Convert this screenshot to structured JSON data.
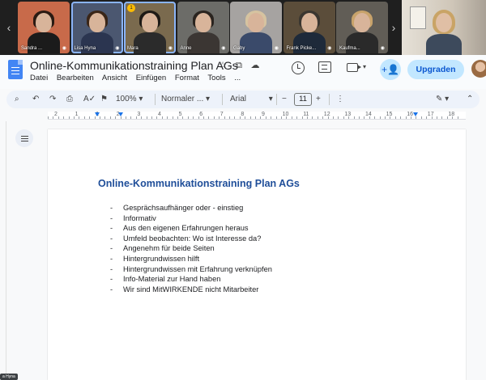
{
  "meeting": {
    "participants": [
      {
        "name": "Sandra ...",
        "bg": "#c86a4a",
        "hair": "#2b1a12",
        "shirt": "#1b1b1b",
        "hand": false,
        "active": false
      },
      {
        "name": "Lisa Hyna",
        "bg": "#4b5770",
        "hair": "#3a2618",
        "shirt": "#2b3550",
        "hand": false,
        "active": true
      },
      {
        "name": "Mara",
        "bg": "#7a6a4e",
        "hair": "#1e1a16",
        "shirt": "#2b2b2b",
        "hand": true,
        "active": true
      },
      {
        "name": "Anne",
        "bg": "#6c6c68",
        "hair": "#2a241f",
        "shirt": "#3b3633",
        "hand": false,
        "active": false
      },
      {
        "name": "Gaby",
        "bg": "#a6a3a1",
        "hair": "#d6c3a0",
        "shirt": "#3a4a6a",
        "hand": false,
        "active": false
      },
      {
        "name": "Frank Picke...",
        "bg": "#5b4d3a",
        "hair": "#3a3630",
        "shirt": "#1e2a3a",
        "hand": false,
        "active": false
      },
      {
        "name": "Kaufma...",
        "bg": "#615d56",
        "hair": "#c8a36b",
        "shirt": "#2a2a2a",
        "hand": false,
        "active": false
      }
    ],
    "hand_badge": "1",
    "self_label": "a Hyna"
  },
  "doc": {
    "title": "Online-Kommunikationstraining Plan AGs",
    "menu": [
      "Datei",
      "Bearbeiten",
      "Ansicht",
      "Einfügen",
      "Format",
      "Tools",
      "..."
    ],
    "upgrade_label": "Upgraden",
    "heading": "Online-Kommunikationstraining Plan AGs",
    "bullets": [
      "Gesprächsaufhänger oder - einstieg",
      "Informativ",
      "Aus den eigenen Erfahrungen heraus",
      "Umfeld beobachten: Wo ist Interesse da?",
      "Angenehm für beide Seiten",
      "Hintergrundwissen hilft",
      "Hintergrundwissen mit Erfahrung verknüpfen",
      "Info-Material zur Hand haben",
      "Wir sind MitWIRKENDE nicht Mitarbeiter"
    ]
  },
  "toolbar": {
    "zoom": "100%",
    "style": "Normaler ...",
    "font": "Arial",
    "font_size": "11"
  },
  "ruler": {
    "numbers": [
      "2",
      "1",
      "1",
      "2",
      "3",
      "4",
      "5",
      "6",
      "7",
      "8",
      "9",
      "10",
      "11",
      "12",
      "13",
      "14",
      "15",
      "16",
      "17",
      "18"
    ]
  },
  "colors": {
    "heading": "#1f4e99",
    "accent": "#0b57d0",
    "upgrade_bg": "#c2e7ff"
  }
}
